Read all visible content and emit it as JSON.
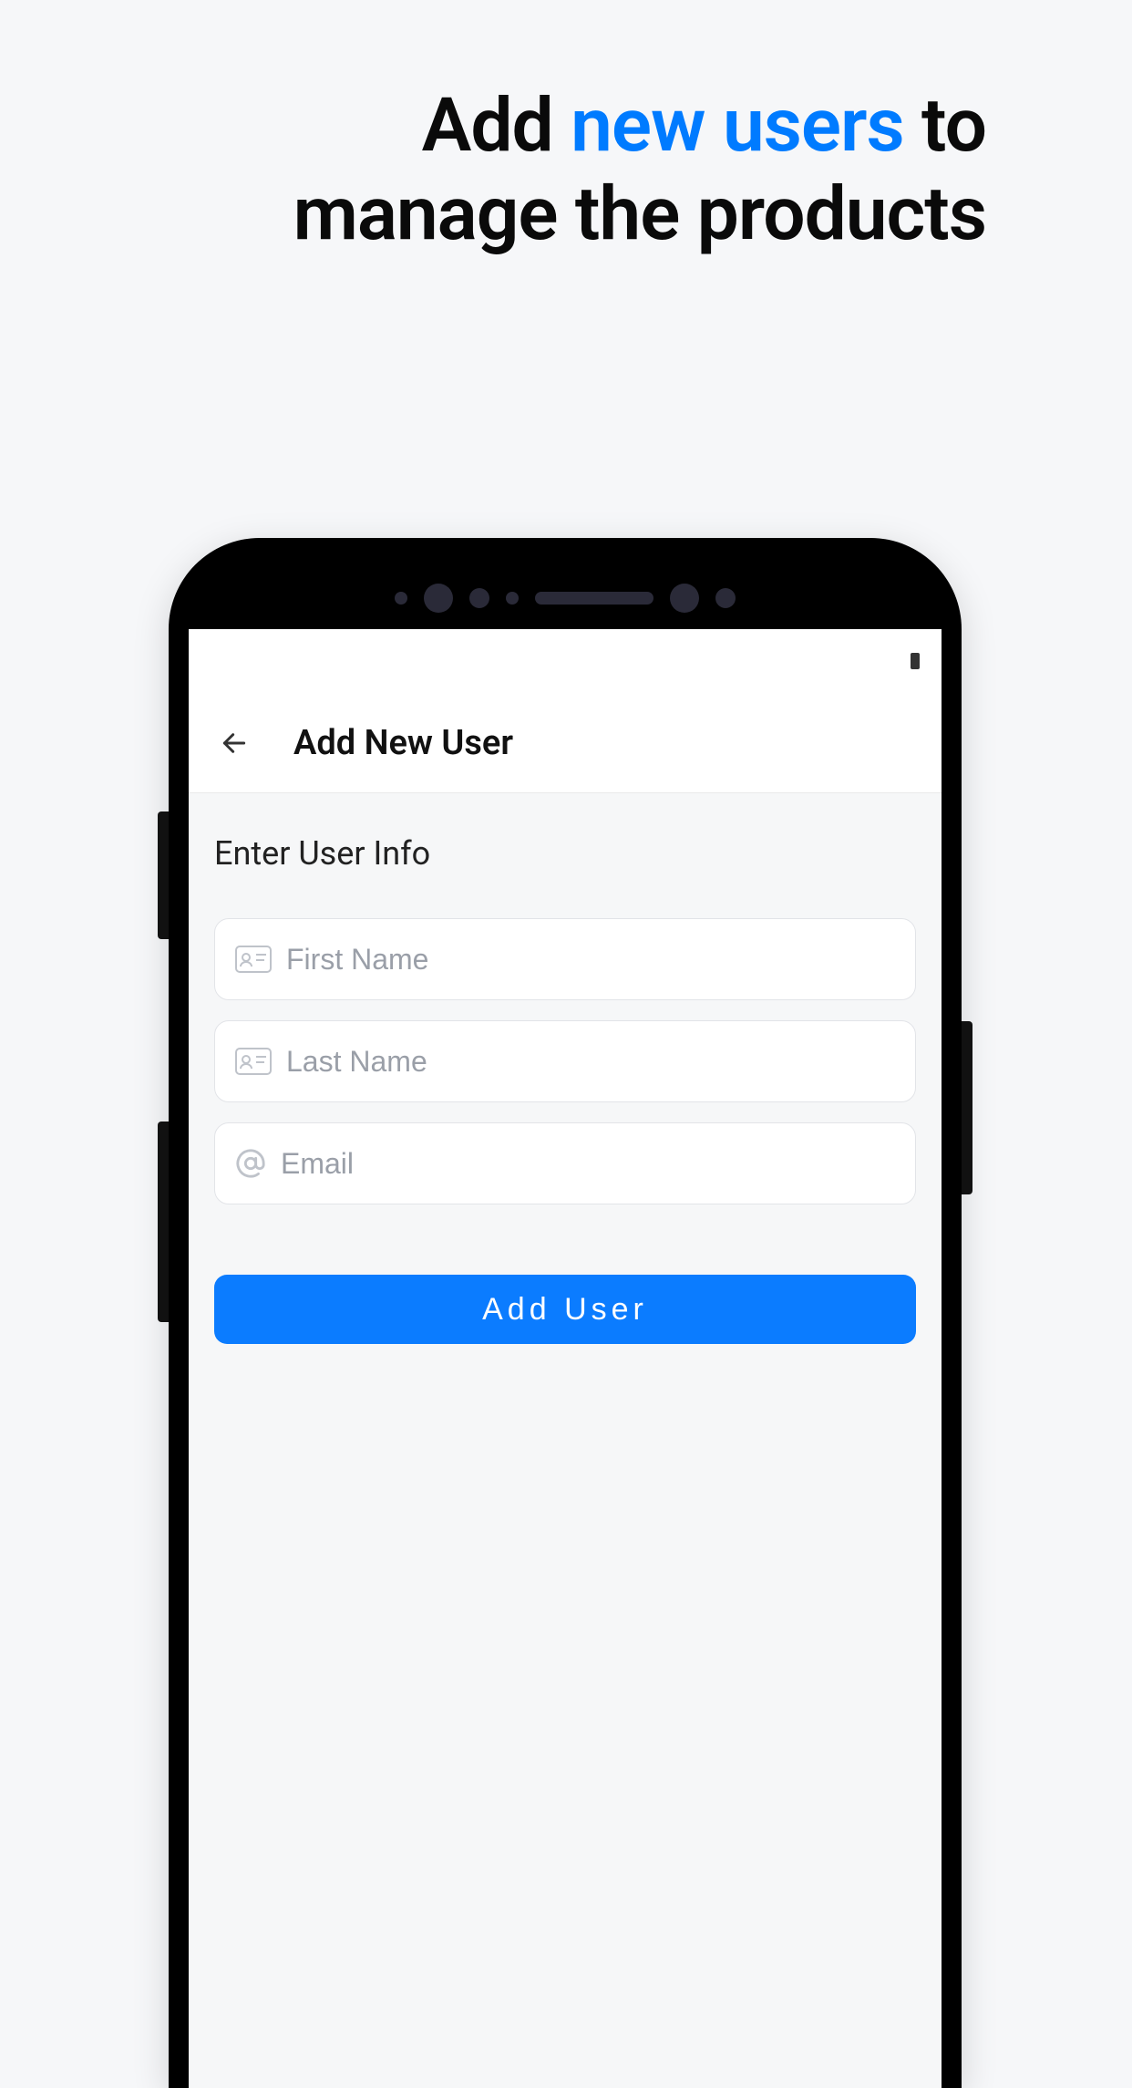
{
  "headline": {
    "part1": "Add ",
    "accent": "new users",
    "part2": " to manage the products"
  },
  "appBar": {
    "title": "Add New User"
  },
  "form": {
    "sectionTitle": "Enter User Info",
    "firstName": {
      "placeholder": "First Name",
      "value": ""
    },
    "lastName": {
      "placeholder": "Last Name",
      "value": ""
    },
    "email": {
      "placeholder": "Email",
      "value": ""
    },
    "submitLabel": "Add User"
  }
}
